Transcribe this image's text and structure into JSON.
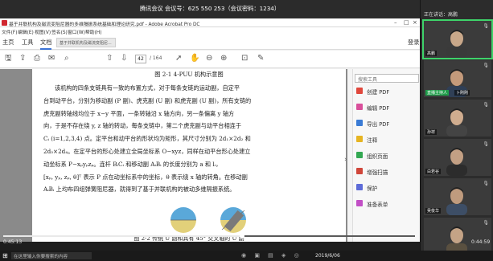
{
  "meeting": {
    "title": "腾讯会议 会议号：625 550 253（会议密码：1234）",
    "panel_header": "正在讲话：高鹏"
  },
  "acrobat": {
    "title": "基于并联机构及磁流变阻尼器的多维隔振系统基础和理论研究.pdf - Adobe Acrobat Pro DC",
    "menu": [
      "文件(F)",
      "编辑(E)",
      "视图(V)",
      "签名(S)",
      "窗口(W)",
      "帮助(H)"
    ],
    "tabs": [
      "主页",
      "工具",
      "文档"
    ],
    "tab_file": "基于并联机构及磁流变阻尼...",
    "login": "登录",
    "page_num": "42",
    "page_total": "/ 164"
  },
  "document": {
    "caption_top": "图 2-1 4-PUU 机构示意图",
    "lines": [
      "该机构的四条支链具有一致的布置方式，对于每条支链的运动副，自定平",
      "台到动平台，分别为移动副 (P 副)、虎克副 (U 副) 和虎克副 (U 副)，所有支链的",
      "虎克副转轴线均位于 x−y 平面，一条转轴沿 x 轴方向，另一条偏离 y 轴方",
      "向，于是不存在绕 y, z 轴的转动，每条支链中，第二个虎克副与动平台相连于",
      "Cᵢ (i=1,2,3,4) 点。定平台和动平台的形状均为矩形，其尺寸分别为 2d₁×2d₂ 和",
      "2d₃×2d₄。在定平台的形心处建立全局坐标系 O−xyz，同样在动平台形心处建立",
      "动坐标系 P−xₚyₚzₚ。连杆 BᵢCᵢ 和移动副 AᵢBᵢ 的长度分别为 a 和 lᵢ，",
      "[xₚ, yₚ, zₚ, θ]ᵀ 表示 P 点在动坐标系中的坐标，θ 表示绕 x 轴的转角。在移动副",
      "AᵢBᵢ 上均布四组弹簧阻尼器，就得到了基于并联机构的被动多维隔振系统。"
    ],
    "caption_bottom": "图 2-2 传统 U 副和具有 45° 交叉轴的 U 副"
  },
  "tools_panel": {
    "search_placeholder": "搜索工具",
    "items": [
      {
        "label": "创建 PDF",
        "color": "#e0473c"
      },
      {
        "label": "编辑 PDF",
        "color": "#d94f9b"
      },
      {
        "label": "导出 PDF",
        "color": "#3a7bd5"
      },
      {
        "label": "注释",
        "color": "#e6b422"
      },
      {
        "label": "组织页面",
        "color": "#33a852"
      },
      {
        "label": "增强扫描",
        "color": "#d0463a"
      },
      {
        "label": "保护",
        "color": "#5d6bd8"
      },
      {
        "label": "准备表单",
        "color": "#c24fc6"
      }
    ]
  },
  "participants": [
    {
      "name": "高鹏",
      "badge": "",
      "skin": "#c9a88a",
      "shirt": "#3a3a3a"
    },
    {
      "name": "卜刚刚",
      "badge": "直播主持人",
      "skin": "#c49a7b",
      "shirt": "#2f3f56"
    },
    {
      "name": "孙祥",
      "badge": "",
      "skin": "#d0ad8f",
      "shirt": "#444444"
    },
    {
      "name": "白若谷",
      "badge": "",
      "skin": "#c3a084",
      "shirt": "#2c2c2c"
    },
    {
      "name": "吴俊华",
      "badge": "",
      "skin": "#bf9b7e",
      "shirt": "#3d4e66"
    },
    {
      "name": "",
      "badge": "",
      "skin": "#c4a386",
      "shirt": "#5a5040"
    }
  ],
  "video": {
    "time_elapsed": "0:45:13",
    "time_remaining": "0:44:59",
    "progress": 0.58
  },
  "taskbar": {
    "search_placeholder": "在这里输入你要搜索的内容",
    "clock": "2019/6/06"
  }
}
